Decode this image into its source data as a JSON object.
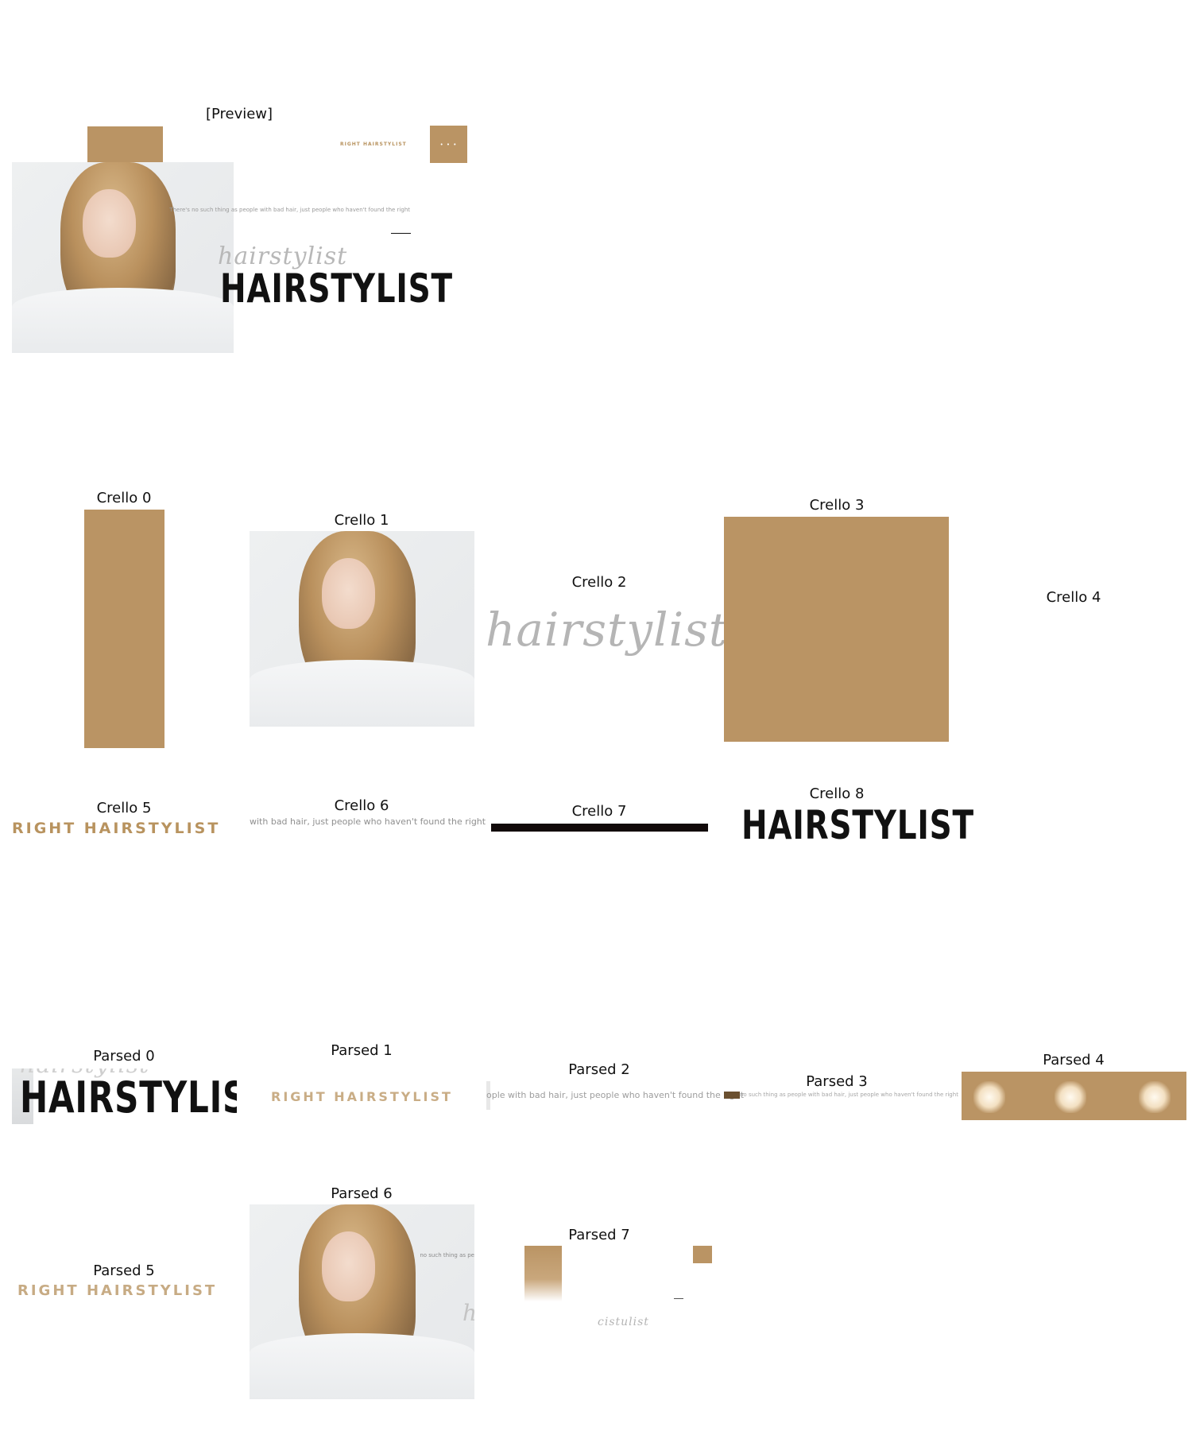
{
  "preview": {
    "label": "[Preview]",
    "brand": "RIGHT HAIRSTYLIST",
    "menu_dots": "• • •",
    "quote": "There's no such thing as people with bad hair, just people who haven't found the right",
    "script_word": "hairstylist",
    "title": "HAIRSTYLIST"
  },
  "crello": {
    "labels": [
      "Crello 0",
      "Crello 1",
      "Crello 2",
      "Crello 3",
      "Crello 4",
      "Crello 5",
      "Crello 6",
      "Crello 7",
      "Crello 8"
    ],
    "script_word": "hairstylist",
    "brand": "RIGHT HAIRSTYLIST",
    "quote_fragment": "with bad hair, just people who haven't found the right",
    "title": "HAIRSTYLIST"
  },
  "parsed": {
    "labels": [
      "Parsed 0",
      "Parsed 1",
      "Parsed 2",
      "Parsed 3",
      "Parsed 4",
      "Parsed 5",
      "Parsed 6",
      "Parsed 7"
    ],
    "title": "HAIRSTYLIST",
    "brand": "RIGHT HAIRSTYLIST",
    "quote_fragment": "ople with bad hair, just people who haven't found the right",
    "quote_small": "no such thing as people with bad hair, just people who haven't found the right",
    "photo_overlay": "no such thing as pe",
    "script_fragment": "cistulist"
  },
  "colors": {
    "tan": "#ba9464",
    "brand_text": "#b8935f",
    "title": "#111111",
    "script": "#b8b8b8"
  }
}
